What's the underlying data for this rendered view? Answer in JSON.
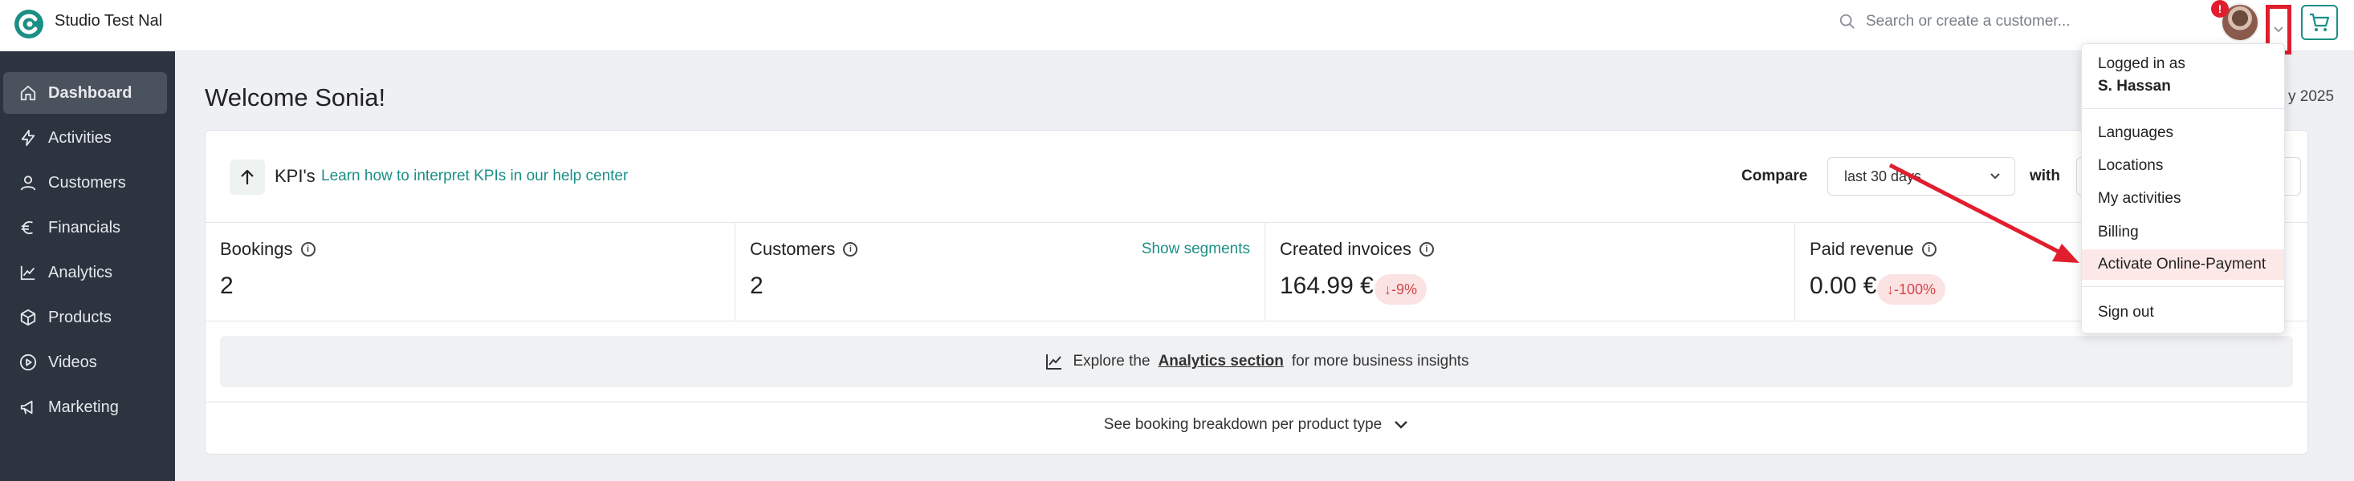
{
  "app": {
    "studio_name": "Studio Test Nal"
  },
  "header": {
    "search_placeholder": "Search or create a customer...",
    "notification_count": "!",
    "accent_color": "#1b8f86"
  },
  "sidebar": {
    "items": [
      {
        "label": "Dashboard",
        "icon": "home-icon",
        "active": true
      },
      {
        "label": "Activities",
        "icon": "bolt-icon"
      },
      {
        "label": "Customers",
        "icon": "user-icon"
      },
      {
        "label": "Financials",
        "icon": "euro-icon"
      },
      {
        "label": "Analytics",
        "icon": "chart-line-icon"
      },
      {
        "label": "Products",
        "icon": "box-icon"
      },
      {
        "label": "Videos",
        "icon": "play-icon"
      },
      {
        "label": "Marketing",
        "icon": "megaphone-icon"
      }
    ]
  },
  "main": {
    "welcome": "Welcome Sonia!",
    "date_fragment": "y 2025",
    "kpi_header": {
      "title": "KPI's",
      "help_link": "Learn how to interpret KPIs in our help center",
      "compare_label": "Compare",
      "compare_value": "last 30 days",
      "with_label": "with"
    },
    "kpis": [
      {
        "name": "Bookings",
        "value": "2"
      },
      {
        "name": "Customers",
        "value": "2",
        "link": "Show segments"
      },
      {
        "name": "Created invoices",
        "value": "164.99 €",
        "delta": "↓-9%"
      },
      {
        "name": "Paid revenue",
        "value": "0.00 €",
        "delta": "↓-100%"
      }
    ],
    "explore": {
      "prefix": "Explore the",
      "link": "Analytics section",
      "suffix": "for more business insights"
    },
    "breakdown": "See booking breakdown per product type"
  },
  "user_menu": {
    "logged_in_label": "Logged in as",
    "user_name": "S. Hassan",
    "items": [
      "Languages",
      "Locations",
      "My activities",
      "Billing",
      "Activate Online-Payment"
    ],
    "sign_out": "Sign out",
    "highlight_color": "#e01e2d"
  }
}
